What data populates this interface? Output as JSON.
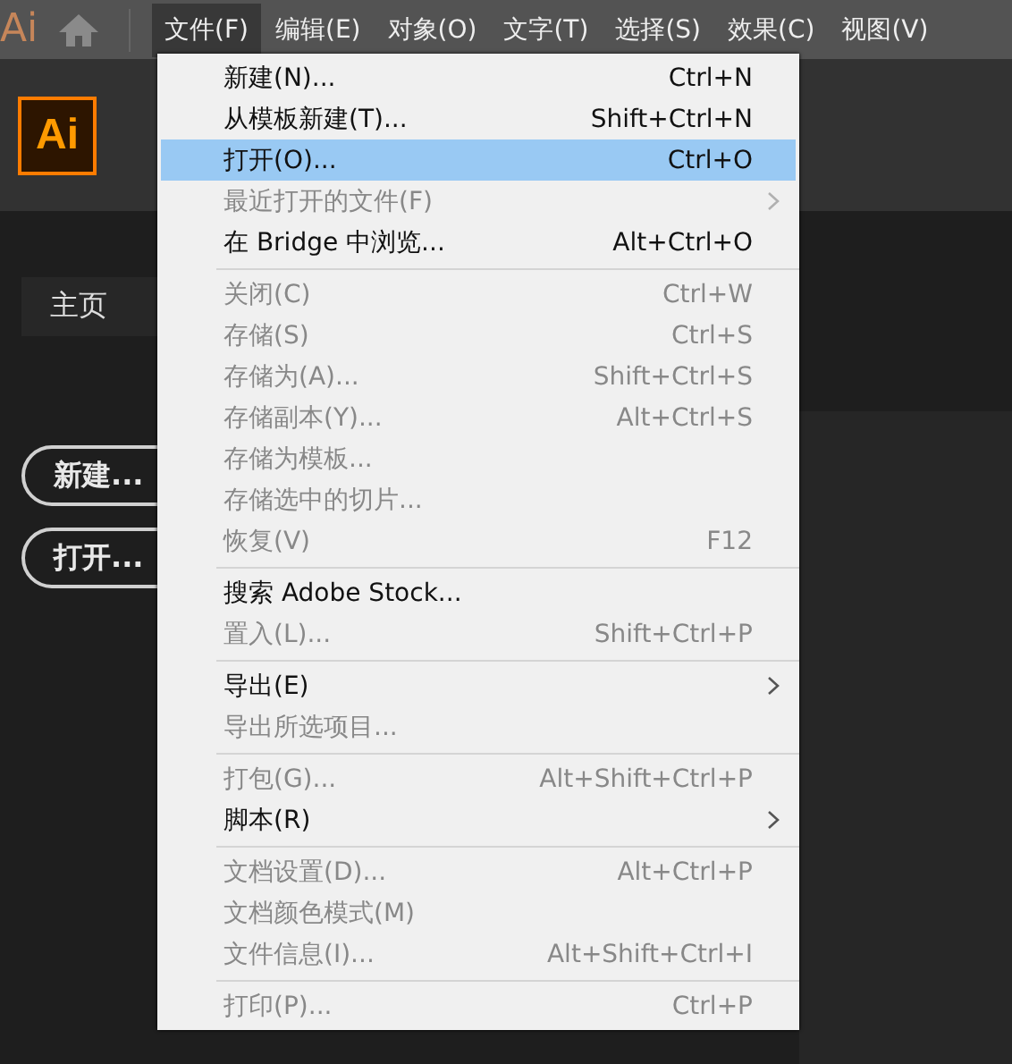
{
  "app_logo_partial": "Ai",
  "menubar": [
    {
      "label": "文件(F)",
      "selected": true
    },
    {
      "label": "编辑(E)",
      "selected": false
    },
    {
      "label": "对象(O)",
      "selected": false
    },
    {
      "label": "文字(T)",
      "selected": false
    },
    {
      "label": "选择(S)",
      "selected": false
    },
    {
      "label": "效果(C)",
      "selected": false
    },
    {
      "label": "视图(V)",
      "selected": false
    }
  ],
  "logo": "Ai",
  "home_tab": "主页",
  "buttons": [
    "新建...",
    "打开..."
  ],
  "menu": [
    {
      "kind": "item",
      "label": "新建(N)...",
      "shortcut": "Ctrl+N",
      "disabled": false,
      "selected": false
    },
    {
      "kind": "item",
      "label": "从模板新建(T)...",
      "shortcut": "Shift+Ctrl+N",
      "disabled": false,
      "selected": false
    },
    {
      "kind": "item",
      "label": "打开(O)...",
      "shortcut": "Ctrl+O",
      "disabled": false,
      "selected": true
    },
    {
      "kind": "submenu",
      "label": "最近打开的文件(F)",
      "disabled": true,
      "selected": false
    },
    {
      "kind": "item",
      "label": "在 Bridge 中浏览...",
      "shortcut": "Alt+Ctrl+O",
      "disabled": false,
      "selected": false
    },
    {
      "kind": "separator"
    },
    {
      "kind": "item",
      "label": "关闭(C)",
      "shortcut": "Ctrl+W",
      "disabled": true,
      "selected": false
    },
    {
      "kind": "item",
      "label": "存储(S)",
      "shortcut": "Ctrl+S",
      "disabled": true,
      "selected": false
    },
    {
      "kind": "item",
      "label": "存储为(A)...",
      "shortcut": "Shift+Ctrl+S",
      "disabled": true,
      "selected": false
    },
    {
      "kind": "item",
      "label": "存储副本(Y)...",
      "shortcut": "Alt+Ctrl+S",
      "disabled": true,
      "selected": false
    },
    {
      "kind": "item",
      "label": "存储为模板...",
      "disabled": true,
      "selected": false
    },
    {
      "kind": "item",
      "label": "存储选中的切片...",
      "disabled": true,
      "selected": false
    },
    {
      "kind": "item",
      "label": "恢复(V)",
      "shortcut": "F12",
      "disabled": true,
      "selected": false
    },
    {
      "kind": "separator"
    },
    {
      "kind": "item",
      "label": "搜索 Adobe Stock...",
      "disabled": false,
      "selected": false
    },
    {
      "kind": "item",
      "label": "置入(L)...",
      "shortcut": "Shift+Ctrl+P",
      "disabled": true,
      "selected": false
    },
    {
      "kind": "separator"
    },
    {
      "kind": "submenu",
      "label": "导出(E)",
      "disabled": false,
      "selected": false
    },
    {
      "kind": "item",
      "label": "导出所选项目...",
      "disabled": true,
      "selected": false
    },
    {
      "kind": "separator"
    },
    {
      "kind": "item",
      "label": "打包(G)...",
      "shortcut": "Alt+Shift+Ctrl+P",
      "disabled": true,
      "selected": false
    },
    {
      "kind": "submenu",
      "label": "脚本(R)",
      "disabled": false,
      "selected": false
    },
    {
      "kind": "separator"
    },
    {
      "kind": "item",
      "label": "文档设置(D)...",
      "shortcut": "Alt+Ctrl+P",
      "disabled": true,
      "selected": false
    },
    {
      "kind": "item",
      "label": "文档颜色模式(M)",
      "disabled": true,
      "selected": false
    },
    {
      "kind": "item",
      "label": "文件信息(I)...",
      "shortcut": "Alt+Shift+Ctrl+I",
      "disabled": true,
      "selected": false
    },
    {
      "kind": "separator"
    },
    {
      "kind": "item",
      "label": "打印(P)...",
      "shortcut": "Ctrl+P",
      "disabled": true,
      "selected": false
    }
  ]
}
